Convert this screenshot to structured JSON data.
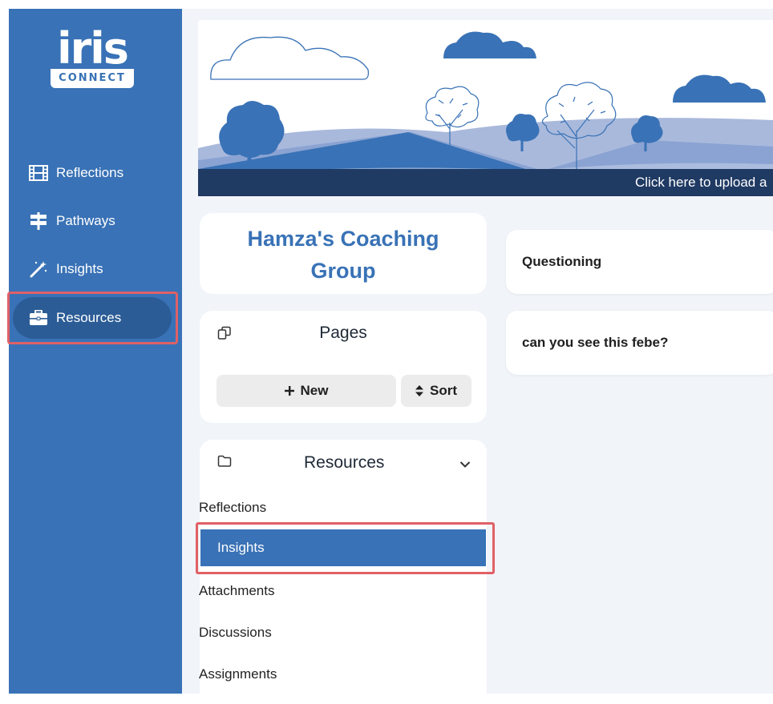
{
  "logo": {
    "word": "iris",
    "badge": "CONNECT"
  },
  "sidebar": {
    "items": [
      {
        "label": "Reflections",
        "icon": "film-icon"
      },
      {
        "label": "Pathways",
        "icon": "signpost-icon"
      },
      {
        "label": "Insights",
        "icon": "magic-wand-icon"
      },
      {
        "label": "Resources",
        "icon": "briefcase-icon",
        "active": true
      }
    ]
  },
  "banner": {
    "upload_text": "Click here to upload a"
  },
  "group": {
    "title_line1": "Hamza's Coaching",
    "title_line2": "Group"
  },
  "pages_panel": {
    "title": "Pages",
    "new_label": "New",
    "sort_label": "Sort"
  },
  "resources_panel": {
    "title": "Resources",
    "items": [
      "Reflections",
      "Insights",
      "Attachments",
      "Discussions",
      "Assignments"
    ],
    "active_index": 1
  },
  "page_cards": [
    "Questioning",
    "can you see this febe?"
  ],
  "colors": {
    "brand": "#3972b6",
    "sidebar_active": "#2b5c96",
    "highlight": "#e06066"
  }
}
